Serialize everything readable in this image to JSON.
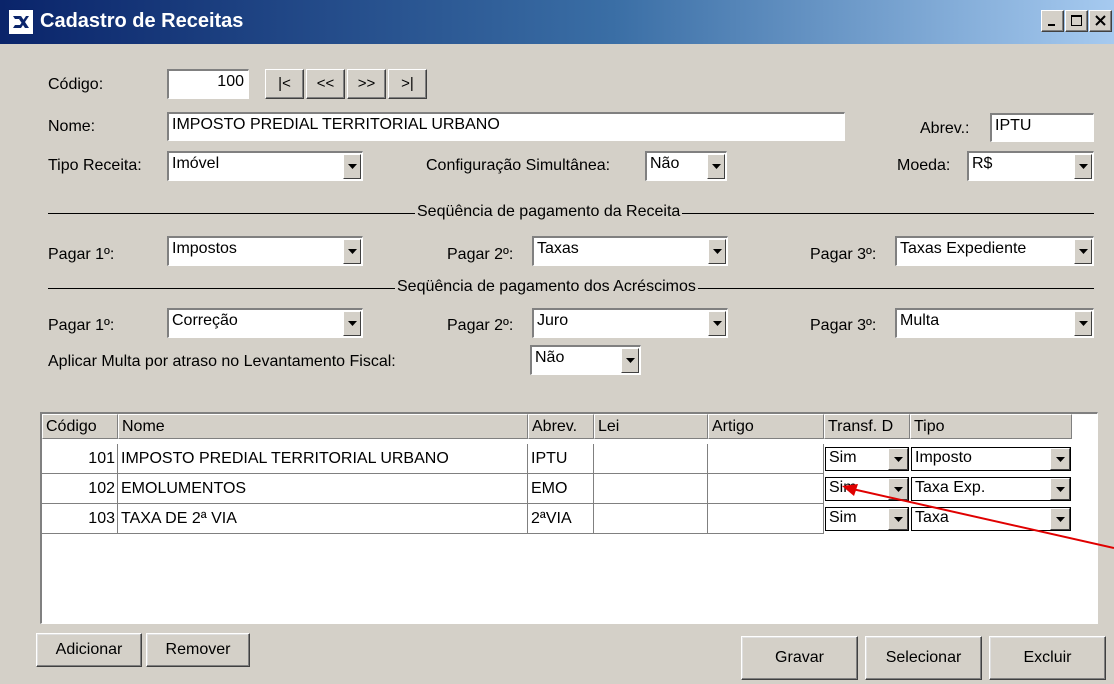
{
  "window": {
    "title": "Cadastro de Receitas",
    "controls": [
      "minimize-icon",
      "maximize-icon",
      "close-icon"
    ]
  },
  "form": {
    "codigo_label": "Código:",
    "codigo_value": "100",
    "nav": [
      {
        "label": "|<",
        "icon": "first-record-icon"
      },
      {
        "label": "<<",
        "icon": "previous-record-icon"
      },
      {
        "label": ">>",
        "icon": "next-record-icon"
      },
      {
        "label": ">|",
        "icon": "last-record-icon"
      }
    ],
    "nome_label": "Nome:",
    "nome_value": "IMPOSTO PREDIAL TERRITORIAL URBANO",
    "abrev_label": "Abrev.:",
    "abrev_value": "IPTU",
    "tipo_receita_label": "Tipo Receita:",
    "tipo_receita_value": "Imóvel",
    "config_label": "Configuração Simultânea:",
    "config_value": "Não",
    "moeda_label": "Moeda:",
    "moeda_value": "R$"
  },
  "seq_receita": {
    "title": "Seqüência de pagamento da Receita",
    "pagar1_label": "Pagar 1º:",
    "pagar1_value": "Impostos",
    "pagar2_label": "Pagar 2º:",
    "pagar2_value": "Taxas",
    "pagar3_label": "Pagar 3º:",
    "pagar3_value": "Taxas Expediente"
  },
  "seq_acrescimos": {
    "title": "Seqüência de pagamento dos Acréscimos",
    "pagar1_label": "Pagar 1º:",
    "pagar1_value": "Correção",
    "pagar2_label": "Pagar 2º:",
    "pagar2_value": "Juro",
    "pagar3_label": "Pagar 3º:",
    "pagar3_value": "Multa"
  },
  "multa": {
    "label": "Aplicar Multa por atraso no Levantamento Fiscal:",
    "value": "Não"
  },
  "grid": {
    "columns": [
      "Código",
      "Nome",
      "Abrev.",
      "Lei",
      "Artigo",
      "Transf. D",
      "Tipo"
    ],
    "rows": [
      {
        "codigo": "101",
        "nome": "IMPOSTO PREDIAL TERRITORIAL URBANO",
        "abrev": "IPTU",
        "lei": "",
        "artigo": "",
        "transf": "Sim",
        "tipo": "Imposto"
      },
      {
        "codigo": "102",
        "nome": "EMOLUMENTOS",
        "abrev": "EMO",
        "lei": "",
        "artigo": "",
        "transf": "Sim",
        "tipo": "Taxa Exp."
      },
      {
        "codigo": "103",
        "nome": "TAXA DE 2ª VIA",
        "abrev": "2ªVIA",
        "lei": "",
        "artigo": "",
        "transf": "Sim",
        "tipo": "Taxa"
      }
    ]
  },
  "buttons": {
    "adicionar": "Adicionar",
    "remover": "Remover",
    "gravar": "Gravar",
    "selecionar": "Selecionar",
    "excluir": "Excluir"
  },
  "annotation": {
    "arrow_color": "#e00000"
  },
  "colors": {
    "face": "#d4d0c8",
    "title_start": "#0a246a",
    "title_end": "#a6caf0"
  }
}
